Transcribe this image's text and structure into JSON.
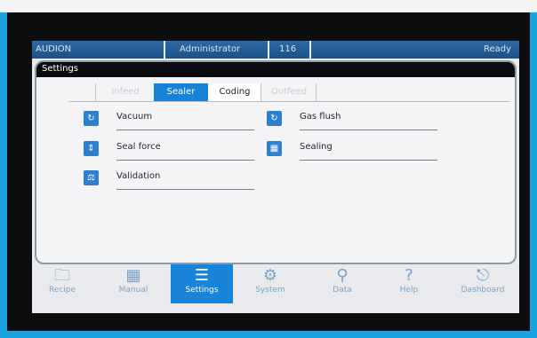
{
  "status": {
    "brand": "AUDION",
    "user": "Administrator",
    "code": "116",
    "state": "Ready"
  },
  "panel": {
    "title": "Settings",
    "tabs": [
      {
        "label": "Infeed",
        "state": "disabled"
      },
      {
        "label": "Sealer",
        "state": "active"
      },
      {
        "label": "Coding",
        "state": "selected"
      },
      {
        "label": "Outfeed",
        "state": "disabled"
      }
    ],
    "items": [
      {
        "label": "Vacuum",
        "icon": "vacuum-icon"
      },
      {
        "label": "Gas flush",
        "icon": "gas-flush-icon"
      },
      {
        "label": "Seal force",
        "icon": "seal-force-icon"
      },
      {
        "label": "Sealing",
        "icon": "sealing-icon"
      },
      {
        "label": "Validation",
        "icon": "validation-icon"
      }
    ]
  },
  "nav": [
    {
      "label": "Recipe",
      "icon": "folder-icon"
    },
    {
      "label": "Manual",
      "icon": "keypad-icon"
    },
    {
      "label": "Settings",
      "icon": "list-icon",
      "active": true
    },
    {
      "label": "System",
      "icon": "gears-icon"
    },
    {
      "label": "Data",
      "icon": "magnifier-icon"
    },
    {
      "label": "Help",
      "icon": "question-icon"
    },
    {
      "label": "Dashboard",
      "icon": "power-icon"
    }
  ],
  "colors": {
    "accent": "#1683d8",
    "frame": "#1aa3df",
    "statusbar": "#245d98"
  }
}
